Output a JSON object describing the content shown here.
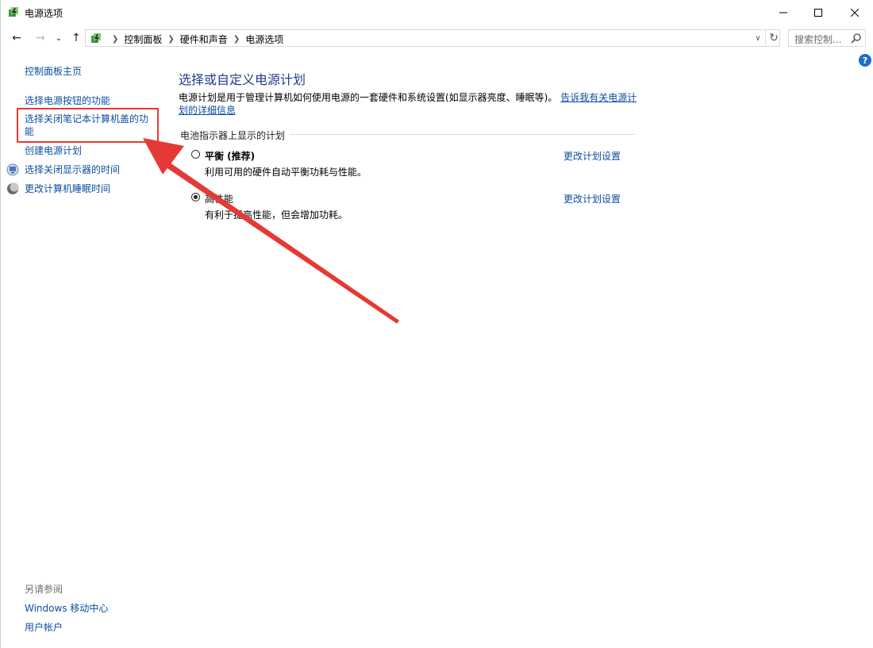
{
  "window": {
    "title": "电源选项",
    "controls": {
      "minimize": "—",
      "maximize": "☐",
      "close": "✕"
    }
  },
  "nav": {
    "back": "←",
    "forward": "→",
    "recent": "⌄",
    "up": "↑",
    "breadcrumb": [
      "控制面板",
      "硬件和声音",
      "电源选项"
    ],
    "search_placeholder": "搜索控制..."
  },
  "help": {
    "label": "?"
  },
  "sidebar": {
    "home": "控制面板主页",
    "items": [
      "选择电源按钮的功能",
      "选择关闭笔记本计算机盖的功能",
      "创建电源计划",
      "选择关闭显示器的时间",
      "更改计算机睡眠时间"
    ],
    "see_also_title": "另请参阅",
    "see_also": [
      "Windows 移动中心",
      "用户帐户"
    ]
  },
  "main": {
    "title": "选择或自定义电源计划",
    "description": "电源计划是用于管理计算机如何使用电源的一套硬件和系统设置(如显示器亮度、睡眠等)。",
    "description_link": "告诉我有关电源计划的详细信息",
    "group_title": "电池指示器上显示的计划",
    "plans": [
      {
        "name": "平衡 (推荐)",
        "description": "利用可用的硬件自动平衡功耗与性能。",
        "selected": false,
        "link": "更改计划设置"
      },
      {
        "name": "高性能",
        "description": "有利于提高性能，但会增加功耗。",
        "selected": true,
        "link": "更改计划设置"
      }
    ]
  },
  "colors": {
    "link": "#0b4ea2",
    "title": "#1e3f8a",
    "annotation": "#e53935"
  }
}
